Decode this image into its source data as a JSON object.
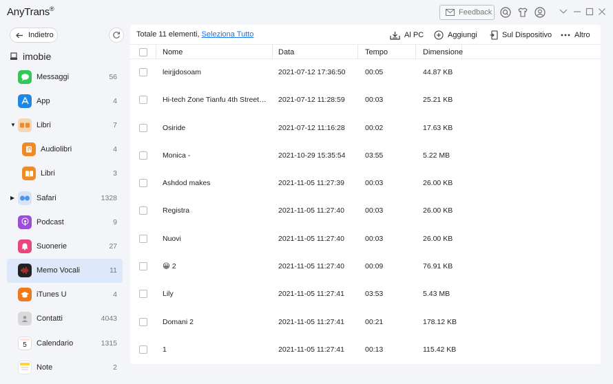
{
  "app": {
    "title": "AnyTrans",
    "reg": "®",
    "feedback_label": "Feedback"
  },
  "sidebar": {
    "back_label": "Indietro",
    "device_name": "imobie",
    "items": [
      {
        "label": "Messaggi",
        "count": "56",
        "icon": "messages-icon",
        "color": "#34c759",
        "glyph": "💬"
      },
      {
        "label": "App",
        "count": "4",
        "icon": "app-store-icon",
        "color": "#1e88e5",
        "glyph": "A"
      },
      {
        "label": "Libri",
        "count": "7",
        "icon": "books-group-icon",
        "color": "#f39c3d",
        "glyph": "∞"
      },
      {
        "label": "Audiolibri",
        "count": "4",
        "icon": "audiobooks-icon",
        "color": "#f08a24",
        "glyph": "♫"
      },
      {
        "label": "Libri",
        "count": "3",
        "icon": "books-icon",
        "color": "#f08a24",
        "glyph": "📖"
      },
      {
        "label": "Safari",
        "count": "1328",
        "icon": "safari-icon",
        "color": "#4f93e8",
        "glyph": "◉"
      },
      {
        "label": "Podcast",
        "count": "9",
        "icon": "podcast-icon",
        "color": "#9b4fd8",
        "glyph": "◎"
      },
      {
        "label": "Suonerie",
        "count": "27",
        "icon": "ringtones-icon",
        "color": "#e9467b",
        "glyph": "🔔"
      },
      {
        "label": "Memo Vocali",
        "count": "11",
        "icon": "voice-memos-icon",
        "color": "#222222",
        "glyph": "〰"
      },
      {
        "label": "iTunes U",
        "count": "4",
        "icon": "itunes-u-icon",
        "color": "#f07a1a",
        "glyph": "🎓"
      },
      {
        "label": "Contatti",
        "count": "4043",
        "icon": "contacts-icon",
        "color": "#b8b8b8",
        "glyph": "👤"
      },
      {
        "label": "Calendario",
        "count": "1315",
        "icon": "calendar-icon",
        "color": "#ffffff",
        "glyph": "5"
      },
      {
        "label": "Note",
        "count": "2",
        "icon": "notes-icon",
        "color": "#ffd43b",
        "glyph": "≡"
      }
    ]
  },
  "toolbar": {
    "summary": "Totale 11 elementi,",
    "select_all": "Seleziona Tutto",
    "to_pc": "Al PC",
    "add": "Aggiungi",
    "to_device": "Sul Dispositivo",
    "more": "Altro"
  },
  "table": {
    "columns": [
      "Nome",
      "Data",
      "Tempo",
      "Dimensione"
    ],
    "rows": [
      {
        "name": "leirjjdosoam",
        "date": "2021-07-12 17:36:50",
        "time": "00:05",
        "size": "44.87 KB"
      },
      {
        "name": "Hi-tech Zone Tianfu 4th Street N...",
        "date": "2021-07-12 11:28:59",
        "time": "00:03",
        "size": "25.21 KB"
      },
      {
        "name": "Osiride",
        "date": "2021-07-12 11:16:28",
        "time": "00:02",
        "size": "17.63 KB"
      },
      {
        "name": "Monica -",
        "date": "2021-10-29 15:35:54",
        "time": "03:55",
        "size": "5.22 MB"
      },
      {
        "name": "Ashdod makes",
        "date": "2021-11-05 11:27:39",
        "time": "00:03",
        "size": "26.00 KB"
      },
      {
        "name": "Registra",
        "date": "2021-11-05 11:27:40",
        "time": "00:03",
        "size": "26.00 KB"
      },
      {
        "name": "Nuovi",
        "date": "2021-11-05 11:27:40",
        "time": "00:03",
        "size": "26.00 KB"
      },
      {
        "name": "2",
        "emoji": "😀",
        "date": "2021-11-05 11:27:40",
        "time": "00:09",
        "size": "76.91 KB"
      },
      {
        "name": "Lily",
        "date": "2021-11-05 11:27:41",
        "time": "03:53",
        "size": "5.43 MB"
      },
      {
        "name": "Domani 2",
        "date": "2021-11-05 11:27:41",
        "time": "00:21",
        "size": "178.12 KB"
      },
      {
        "name": "1",
        "date": "2021-11-05 11:27:41",
        "time": "00:13",
        "size": "115.42 KB"
      }
    ]
  }
}
